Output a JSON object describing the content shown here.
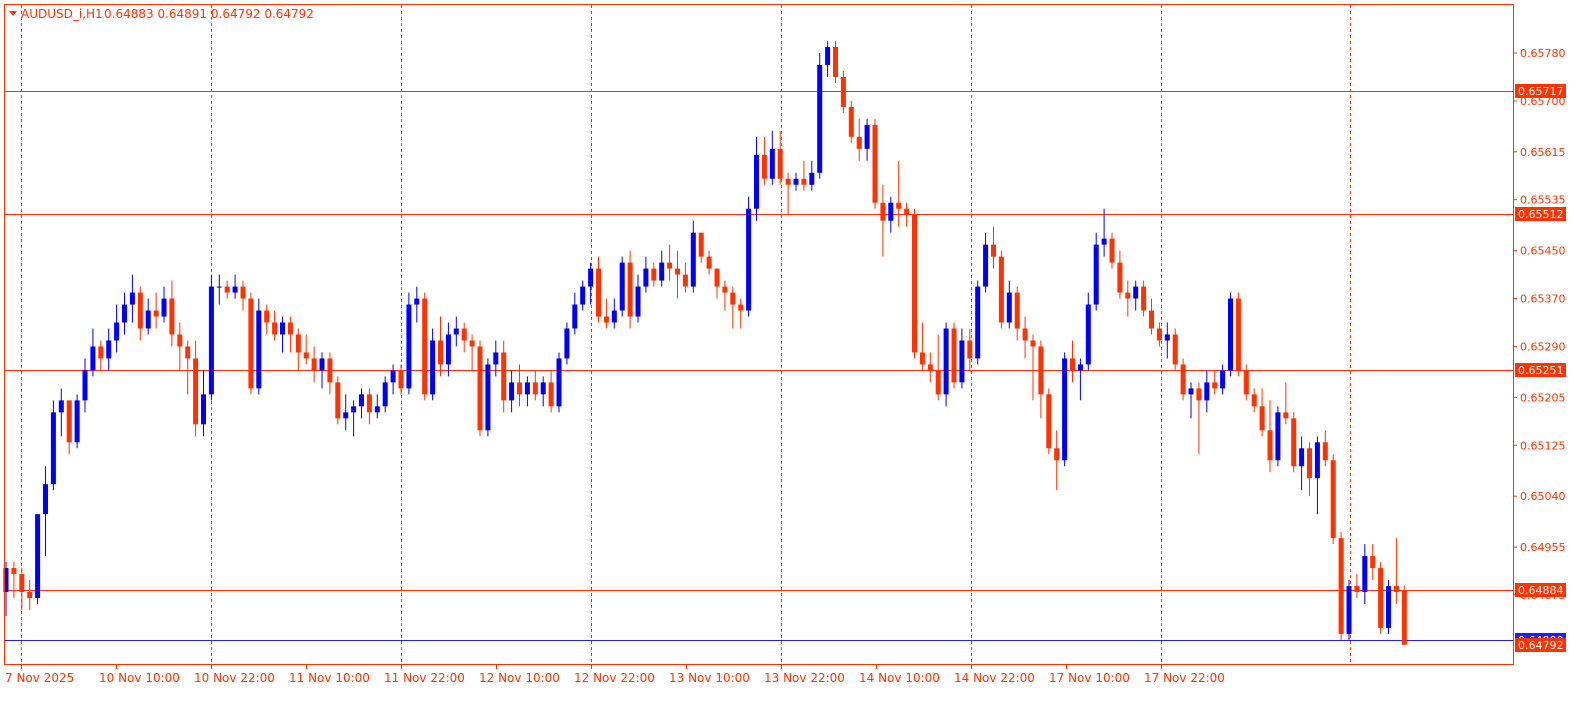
{
  "header": {
    "symbol_tf": "AUDUSD_i,H1",
    "ohlc": "0.64883 0.64891 0.64792 0.64792"
  },
  "colors": {
    "background": "#ffffff",
    "frame": "#ff3300",
    "bull": "#0000ff",
    "bear": "#ff3300",
    "level_line": "#ff3300",
    "bid_line": "#2020ff",
    "grid": "#ff3300",
    "axis_text": "#ff3300"
  },
  "chart_data": {
    "type": "candlestick",
    "timeframe": "H1",
    "y_range": [
      0.64792,
      0.6584
    ],
    "y_ticks": [
      "0.65780",
      "0.65700",
      "0.65615",
      "0.65535",
      "0.65450",
      "0.65370",
      "0.65290",
      "0.65205",
      "0.65125",
      "0.65040",
      "0.64955",
      "0.64875"
    ],
    "x_labels": [
      "7 Nov 2025",
      "10 Nov 10:00",
      "10 Nov 22:00",
      "11 Nov 10:00",
      "11 Nov 22:00",
      "12 Nov 10:00",
      "12 Nov 22:00",
      "13 Nov 10:00",
      "13 Nov 22:00",
      "14 Nov 10:00",
      "14 Nov 22:00",
      "17 Nov 10:00",
      "17 Nov 22:00"
    ],
    "grid": "vertical dashed",
    "levels": [
      {
        "price": 0.65717,
        "label": "0.65717"
      },
      {
        "price": 0.65512,
        "label": "0.65512"
      },
      {
        "price": 0.65251,
        "label": "0.65251"
      },
      {
        "price": 0.64884,
        "label": "0.64884"
      }
    ],
    "bid_line": {
      "price": 0.648,
      "label": "0.64800"
    },
    "current_price": {
      "price": 0.64792,
      "label": "0.64792"
    },
    "candles": [
      [
        0.6488,
        0.6493,
        0.6484,
        0.6492
      ],
      [
        0.6492,
        0.6493,
        0.6487,
        0.6491
      ],
      [
        0.6491,
        0.6492,
        0.6485,
        0.6488
      ],
      [
        0.6488,
        0.649,
        0.6485,
        0.6487
      ],
      [
        0.6487,
        0.6501,
        0.6486,
        0.6501
      ],
      [
        0.6501,
        0.6509,
        0.6494,
        0.6506
      ],
      [
        0.6506,
        0.652,
        0.6505,
        0.6518
      ],
      [
        0.6518,
        0.6522,
        0.6514,
        0.652
      ],
      [
        0.652,
        0.6519,
        0.6511,
        0.6513
      ],
      [
        0.6513,
        0.6521,
        0.6512,
        0.652
      ],
      [
        0.652,
        0.6527,
        0.6518,
        0.6525
      ],
      [
        0.6525,
        0.6532,
        0.6524,
        0.6529
      ],
      [
        0.6529,
        0.653,
        0.6525,
        0.6527
      ],
      [
        0.6527,
        0.6532,
        0.6525,
        0.653
      ],
      [
        0.653,
        0.6536,
        0.6528,
        0.6533
      ],
      [
        0.6533,
        0.6538,
        0.6531,
        0.6536
      ],
      [
        0.6536,
        0.6541,
        0.6533,
        0.6538
      ],
      [
        0.6538,
        0.6539,
        0.653,
        0.6532
      ],
      [
        0.6532,
        0.6537,
        0.6531,
        0.6535
      ],
      [
        0.6535,
        0.6538,
        0.6532,
        0.6534
      ],
      [
        0.6534,
        0.6539,
        0.6533,
        0.6537
      ],
      [
        0.6537,
        0.654,
        0.6529,
        0.6531
      ],
      [
        0.6531,
        0.6533,
        0.6525,
        0.6529
      ],
      [
        0.6529,
        0.653,
        0.6521,
        0.6527
      ],
      [
        0.6527,
        0.653,
        0.6514,
        0.6516
      ],
      [
        0.6516,
        0.6525,
        0.6514,
        0.6521
      ],
      [
        0.6521,
        0.6541,
        0.652,
        0.6539
      ],
      [
        0.6539,
        0.6541,
        0.6536,
        0.6539
      ],
      [
        0.6539,
        0.654,
        0.6537,
        0.6538
      ],
      [
        0.6538,
        0.6541,
        0.6537,
        0.6539
      ],
      [
        0.6539,
        0.654,
        0.6535,
        0.6537
      ],
      [
        0.6537,
        0.6538,
        0.6521,
        0.6522
      ],
      [
        0.6522,
        0.6537,
        0.6521,
        0.6535
      ],
      [
        0.6535,
        0.6536,
        0.6531,
        0.6533
      ],
      [
        0.6533,
        0.6535,
        0.653,
        0.6531
      ],
      [
        0.6531,
        0.6534,
        0.6528,
        0.6533
      ],
      [
        0.6533,
        0.6534,
        0.6528,
        0.6531
      ],
      [
        0.6531,
        0.6532,
        0.6525,
        0.6528
      ],
      [
        0.6528,
        0.6531,
        0.6526,
        0.6527
      ],
      [
        0.6527,
        0.6529,
        0.6523,
        0.6525
      ],
      [
        0.6525,
        0.6528,
        0.6522,
        0.6527
      ],
      [
        0.6527,
        0.6528,
        0.6521,
        0.6523
      ],
      [
        0.6523,
        0.6524,
        0.6516,
        0.6517
      ],
      [
        0.6517,
        0.6521,
        0.6515,
        0.6518
      ],
      [
        0.6518,
        0.652,
        0.6514,
        0.6519
      ],
      [
        0.6519,
        0.6522,
        0.6517,
        0.6521
      ],
      [
        0.6521,
        0.6522,
        0.6516,
        0.6518
      ],
      [
        0.6518,
        0.6521,
        0.6517,
        0.6519
      ],
      [
        0.6519,
        0.6524,
        0.6518,
        0.6523
      ],
      [
        0.6523,
        0.6526,
        0.6521,
        0.6525
      ],
      [
        0.6525,
        0.6526,
        0.6521,
        0.6522
      ],
      [
        0.6522,
        0.6538,
        0.6521,
        0.6536
      ],
      [
        0.6536,
        0.6539,
        0.6533,
        0.6537
      ],
      [
        0.6537,
        0.6538,
        0.652,
        0.6521
      ],
      [
        0.6521,
        0.6532,
        0.652,
        0.653
      ],
      [
        0.653,
        0.6534,
        0.6524,
        0.6526
      ],
      [
        0.6526,
        0.6533,
        0.6524,
        0.6531
      ],
      [
        0.6531,
        0.6534,
        0.6529,
        0.6532
      ],
      [
        0.6532,
        0.6533,
        0.6528,
        0.653
      ],
      [
        0.653,
        0.6531,
        0.6525,
        0.6529
      ],
      [
        0.6529,
        0.653,
        0.6514,
        0.6515
      ],
      [
        0.6515,
        0.6527,
        0.6514,
        0.6526
      ],
      [
        0.6526,
        0.653,
        0.6524,
        0.6528
      ],
      [
        0.6528,
        0.653,
        0.6518,
        0.652
      ],
      [
        0.652,
        0.6525,
        0.6518,
        0.6523
      ],
      [
        0.6523,
        0.6526,
        0.6519,
        0.6521
      ],
      [
        0.6521,
        0.6524,
        0.6519,
        0.6523
      ],
      [
        0.6523,
        0.6525,
        0.652,
        0.6521
      ],
      [
        0.6521,
        0.6524,
        0.6519,
        0.6523
      ],
      [
        0.6523,
        0.6525,
        0.6518,
        0.6519
      ],
      [
        0.6519,
        0.6528,
        0.6518,
        0.6527
      ],
      [
        0.6527,
        0.6533,
        0.6526,
        0.6532
      ],
      [
        0.6532,
        0.6538,
        0.6531,
        0.6536
      ],
      [
        0.6536,
        0.654,
        0.6535,
        0.6539
      ],
      [
        0.6539,
        0.6543,
        0.6536,
        0.6542
      ],
      [
        0.6542,
        0.6544,
        0.6533,
        0.6534
      ],
      [
        0.6534,
        0.6537,
        0.6532,
        0.6533
      ],
      [
        0.6533,
        0.6537,
        0.6532,
        0.6535
      ],
      [
        0.6535,
        0.6544,
        0.6534,
        0.6543
      ],
      [
        0.6543,
        0.6545,
        0.6532,
        0.6534
      ],
      [
        0.6534,
        0.6541,
        0.6533,
        0.6539
      ],
      [
        0.6539,
        0.6544,
        0.6538,
        0.6542
      ],
      [
        0.6542,
        0.6543,
        0.6539,
        0.654
      ],
      [
        0.654,
        0.6545,
        0.6539,
        0.6543
      ],
      [
        0.6543,
        0.6546,
        0.654,
        0.6542
      ],
      [
        0.6542,
        0.6545,
        0.6537,
        0.6541
      ],
      [
        0.6541,
        0.6543,
        0.6538,
        0.6539
      ],
      [
        0.6539,
        0.655,
        0.6538,
        0.6548
      ],
      [
        0.6548,
        0.6547,
        0.6543,
        0.6544
      ],
      [
        0.6544,
        0.6545,
        0.6541,
        0.6542
      ],
      [
        0.6542,
        0.6542,
        0.6537,
        0.6539
      ],
      [
        0.6539,
        0.654,
        0.6535,
        0.6538
      ],
      [
        0.6538,
        0.6539,
        0.6532,
        0.6536
      ],
      [
        0.6536,
        0.6537,
        0.6532,
        0.6535
      ],
      [
        0.6535,
        0.6554,
        0.6534,
        0.6552
      ],
      [
        0.6552,
        0.6564,
        0.655,
        0.6561
      ],
      [
        0.6561,
        0.6564,
        0.6556,
        0.6557
      ],
      [
        0.6557,
        0.6565,
        0.6556,
        0.6562
      ],
      [
        0.6562,
        0.6565,
        0.6556,
        0.6557
      ],
      [
        0.6557,
        0.6558,
        0.6551,
        0.6556
      ],
      [
        0.6556,
        0.6558,
        0.6555,
        0.6557
      ],
      [
        0.6557,
        0.656,
        0.6555,
        0.6556
      ],
      [
        0.6556,
        0.656,
        0.6555,
        0.6558
      ],
      [
        0.6558,
        0.6578,
        0.6557,
        0.6576
      ],
      [
        0.6576,
        0.658,
        0.6574,
        0.6579
      ],
      [
        0.6579,
        0.658,
        0.6573,
        0.6574
      ],
      [
        0.6574,
        0.6575,
        0.6568,
        0.6569
      ],
      [
        0.6569,
        0.657,
        0.6563,
        0.6564
      ],
      [
        0.6564,
        0.6567,
        0.656,
        0.6562
      ],
      [
        0.6562,
        0.6567,
        0.656,
        0.6566
      ],
      [
        0.6566,
        0.6567,
        0.6552,
        0.6553
      ],
      [
        0.6553,
        0.6556,
        0.6544,
        0.655
      ],
      [
        0.655,
        0.6554,
        0.6548,
        0.6553
      ],
      [
        0.6553,
        0.656,
        0.6549,
        0.6552
      ],
      [
        0.6552,
        0.6553,
        0.6549,
        0.6551
      ],
      [
        0.6551,
        0.6552,
        0.6527,
        0.6528
      ],
      [
        0.6528,
        0.6533,
        0.6525,
        0.6526
      ],
      [
        0.6526,
        0.6528,
        0.6523,
        0.6525
      ],
      [
        0.6525,
        0.6531,
        0.652,
        0.6521
      ],
      [
        0.6521,
        0.6533,
        0.6519,
        0.6532
      ],
      [
        0.6532,
        0.6533,
        0.6522,
        0.6523
      ],
      [
        0.6523,
        0.6532,
        0.6522,
        0.653
      ],
      [
        0.653,
        0.6532,
        0.6525,
        0.6527
      ],
      [
        0.6527,
        0.654,
        0.6526,
        0.6539
      ],
      [
        0.6539,
        0.6548,
        0.6538,
        0.6546
      ],
      [
        0.6546,
        0.6549,
        0.6542,
        0.6544
      ],
      [
        0.6544,
        0.6545,
        0.6532,
        0.6533
      ],
      [
        0.6533,
        0.654,
        0.6532,
        0.6538
      ],
      [
        0.6538,
        0.6539,
        0.653,
        0.6532
      ],
      [
        0.6532,
        0.6534,
        0.6527,
        0.653
      ],
      [
        0.653,
        0.6531,
        0.652,
        0.6529
      ],
      [
        0.6529,
        0.653,
        0.6517,
        0.6521
      ],
      [
        0.6521,
        0.6522,
        0.6511,
        0.6512
      ],
      [
        0.6512,
        0.6515,
        0.6505,
        0.651
      ],
      [
        0.651,
        0.6528,
        0.6509,
        0.6527
      ],
      [
        0.6527,
        0.653,
        0.6523,
        0.6525
      ],
      [
        0.6525,
        0.6527,
        0.652,
        0.6526
      ],
      [
        0.6526,
        0.6538,
        0.6525,
        0.6536
      ],
      [
        0.6536,
        0.6548,
        0.6535,
        0.6546
      ],
      [
        0.6546,
        0.6552,
        0.6544,
        0.6547
      ],
      [
        0.6547,
        0.6548,
        0.6542,
        0.6543
      ],
      [
        0.6543,
        0.6545,
        0.6537,
        0.6538
      ],
      [
        0.6538,
        0.654,
        0.6534,
        0.6537
      ],
      [
        0.6537,
        0.654,
        0.6535,
        0.6539
      ],
      [
        0.6539,
        0.654,
        0.6534,
        0.6535
      ],
      [
        0.6535,
        0.6537,
        0.6531,
        0.6532
      ],
      [
        0.6532,
        0.6533,
        0.6529,
        0.653
      ],
      [
        0.653,
        0.6533,
        0.6527,
        0.6531
      ],
      [
        0.6531,
        0.6532,
        0.6525,
        0.6526
      ],
      [
        0.6526,
        0.6527,
        0.652,
        0.6521
      ],
      [
        0.6521,
        0.6523,
        0.6517,
        0.6522
      ],
      [
        0.6522,
        0.6523,
        0.6511,
        0.652
      ],
      [
        0.652,
        0.6525,
        0.6518,
        0.6523
      ],
      [
        0.6523,
        0.6525,
        0.6521,
        0.6522
      ],
      [
        0.6522,
        0.6526,
        0.6521,
        0.6525
      ],
      [
        0.6525,
        0.6538,
        0.6524,
        0.6537
      ],
      [
        0.6537,
        0.6538,
        0.6524,
        0.6525
      ],
      [
        0.6525,
        0.6526,
        0.652,
        0.6521
      ],
      [
        0.6521,
        0.6522,
        0.6518,
        0.6519
      ],
      [
        0.6519,
        0.6522,
        0.6514,
        0.6515
      ],
      [
        0.6515,
        0.652,
        0.6508,
        0.651
      ],
      [
        0.651,
        0.6519,
        0.6509,
        0.6518
      ],
      [
        0.6518,
        0.6523,
        0.6516,
        0.6517
      ],
      [
        0.6517,
        0.6518,
        0.6508,
        0.6509
      ],
      [
        0.6509,
        0.6514,
        0.6505,
        0.6512
      ],
      [
        0.6512,
        0.6513,
        0.6504,
        0.6507
      ],
      [
        0.6507,
        0.6514,
        0.6501,
        0.6513
      ],
      [
        0.6513,
        0.6515,
        0.6509,
        0.651
      ],
      [
        0.651,
        0.6511,
        0.6496,
        0.6497
      ],
      [
        0.6497,
        0.6498,
        0.648,
        0.6481
      ],
      [
        0.6481,
        0.649,
        0.648,
        0.6489
      ],
      [
        0.6489,
        0.6491,
        0.6487,
        0.6488
      ],
      [
        0.6488,
        0.6496,
        0.6486,
        0.6494
      ],
      [
        0.6494,
        0.6496,
        0.649,
        0.6492
      ],
      [
        0.6492,
        0.6493,
        0.6481,
        0.6482
      ],
      [
        0.6482,
        0.649,
        0.6481,
        0.6489
      ],
      [
        0.6489,
        0.6497,
        0.6486,
        0.6488
      ],
      [
        0.64883,
        0.64891,
        0.64792,
        0.64792
      ]
    ]
  }
}
